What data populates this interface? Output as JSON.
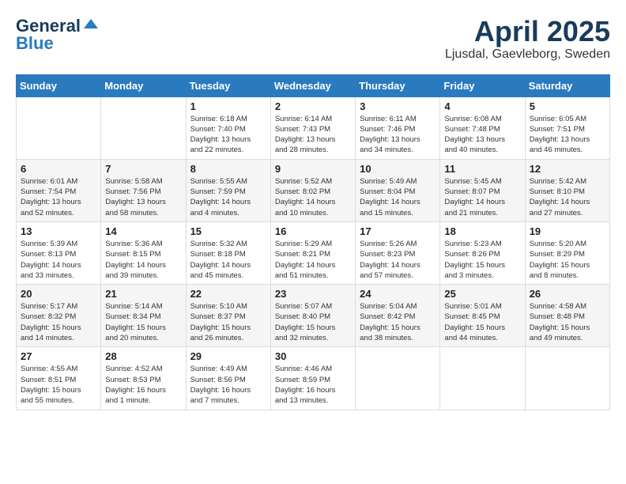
{
  "logo": {
    "part1": "General",
    "part2": "Blue"
  },
  "header": {
    "month": "April 2025",
    "location": "Ljusdal, Gaevleborg, Sweden"
  },
  "weekdays": [
    "Sunday",
    "Monday",
    "Tuesday",
    "Wednesday",
    "Thursday",
    "Friday",
    "Saturday"
  ],
  "weeks": [
    [
      {
        "day": "",
        "info": ""
      },
      {
        "day": "",
        "info": ""
      },
      {
        "day": "1",
        "info": "Sunrise: 6:18 AM\nSunset: 7:40 PM\nDaylight: 13 hours\nand 22 minutes."
      },
      {
        "day": "2",
        "info": "Sunrise: 6:14 AM\nSunset: 7:43 PM\nDaylight: 13 hours\nand 28 minutes."
      },
      {
        "day": "3",
        "info": "Sunrise: 6:11 AM\nSunset: 7:46 PM\nDaylight: 13 hours\nand 34 minutes."
      },
      {
        "day": "4",
        "info": "Sunrise: 6:08 AM\nSunset: 7:48 PM\nDaylight: 13 hours\nand 40 minutes."
      },
      {
        "day": "5",
        "info": "Sunrise: 6:05 AM\nSunset: 7:51 PM\nDaylight: 13 hours\nand 46 minutes."
      }
    ],
    [
      {
        "day": "6",
        "info": "Sunrise: 6:01 AM\nSunset: 7:54 PM\nDaylight: 13 hours\nand 52 minutes."
      },
      {
        "day": "7",
        "info": "Sunrise: 5:58 AM\nSunset: 7:56 PM\nDaylight: 13 hours\nand 58 minutes."
      },
      {
        "day": "8",
        "info": "Sunrise: 5:55 AM\nSunset: 7:59 PM\nDaylight: 14 hours\nand 4 minutes."
      },
      {
        "day": "9",
        "info": "Sunrise: 5:52 AM\nSunset: 8:02 PM\nDaylight: 14 hours\nand 10 minutes."
      },
      {
        "day": "10",
        "info": "Sunrise: 5:49 AM\nSunset: 8:04 PM\nDaylight: 14 hours\nand 15 minutes."
      },
      {
        "day": "11",
        "info": "Sunrise: 5:45 AM\nSunset: 8:07 PM\nDaylight: 14 hours\nand 21 minutes."
      },
      {
        "day": "12",
        "info": "Sunrise: 5:42 AM\nSunset: 8:10 PM\nDaylight: 14 hours\nand 27 minutes."
      }
    ],
    [
      {
        "day": "13",
        "info": "Sunrise: 5:39 AM\nSunset: 8:13 PM\nDaylight: 14 hours\nand 33 minutes."
      },
      {
        "day": "14",
        "info": "Sunrise: 5:36 AM\nSunset: 8:15 PM\nDaylight: 14 hours\nand 39 minutes."
      },
      {
        "day": "15",
        "info": "Sunrise: 5:32 AM\nSunset: 8:18 PM\nDaylight: 14 hours\nand 45 minutes."
      },
      {
        "day": "16",
        "info": "Sunrise: 5:29 AM\nSunset: 8:21 PM\nDaylight: 14 hours\nand 51 minutes."
      },
      {
        "day": "17",
        "info": "Sunrise: 5:26 AM\nSunset: 8:23 PM\nDaylight: 14 hours\nand 57 minutes."
      },
      {
        "day": "18",
        "info": "Sunrise: 5:23 AM\nSunset: 8:26 PM\nDaylight: 15 hours\nand 3 minutes."
      },
      {
        "day": "19",
        "info": "Sunrise: 5:20 AM\nSunset: 8:29 PM\nDaylight: 15 hours\nand 8 minutes."
      }
    ],
    [
      {
        "day": "20",
        "info": "Sunrise: 5:17 AM\nSunset: 8:32 PM\nDaylight: 15 hours\nand 14 minutes."
      },
      {
        "day": "21",
        "info": "Sunrise: 5:14 AM\nSunset: 8:34 PM\nDaylight: 15 hours\nand 20 minutes."
      },
      {
        "day": "22",
        "info": "Sunrise: 5:10 AM\nSunset: 8:37 PM\nDaylight: 15 hours\nand 26 minutes."
      },
      {
        "day": "23",
        "info": "Sunrise: 5:07 AM\nSunset: 8:40 PM\nDaylight: 15 hours\nand 32 minutes."
      },
      {
        "day": "24",
        "info": "Sunrise: 5:04 AM\nSunset: 8:42 PM\nDaylight: 15 hours\nand 38 minutes."
      },
      {
        "day": "25",
        "info": "Sunrise: 5:01 AM\nSunset: 8:45 PM\nDaylight: 15 hours\nand 44 minutes."
      },
      {
        "day": "26",
        "info": "Sunrise: 4:58 AM\nSunset: 8:48 PM\nDaylight: 15 hours\nand 49 minutes."
      }
    ],
    [
      {
        "day": "27",
        "info": "Sunrise: 4:55 AM\nSunset: 8:51 PM\nDaylight: 15 hours\nand 55 minutes."
      },
      {
        "day": "28",
        "info": "Sunrise: 4:52 AM\nSunset: 8:53 PM\nDaylight: 16 hours\nand 1 minute."
      },
      {
        "day": "29",
        "info": "Sunrise: 4:49 AM\nSunset: 8:56 PM\nDaylight: 16 hours\nand 7 minutes."
      },
      {
        "day": "30",
        "info": "Sunrise: 4:46 AM\nSunset: 8:59 PM\nDaylight: 16 hours\nand 13 minutes."
      },
      {
        "day": "",
        "info": ""
      },
      {
        "day": "",
        "info": ""
      },
      {
        "day": "",
        "info": ""
      }
    ]
  ]
}
